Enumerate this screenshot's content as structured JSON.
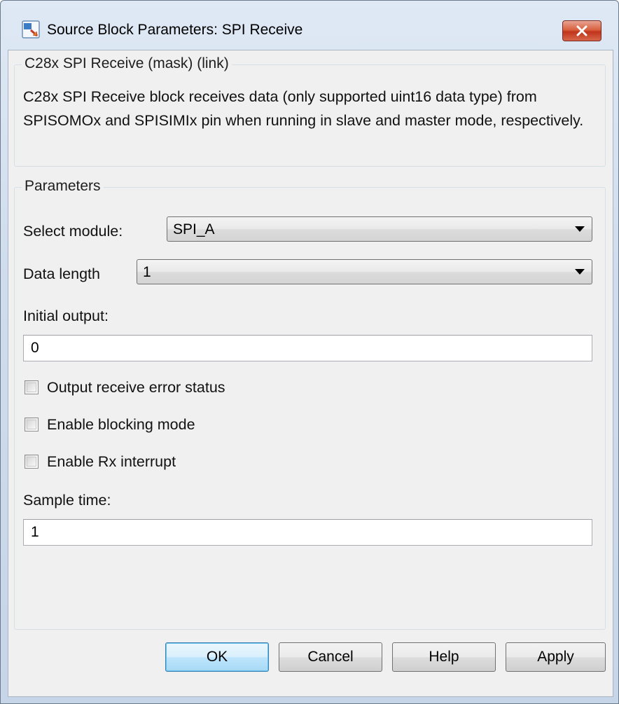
{
  "window": {
    "title": "Source Block Parameters: SPI Receive"
  },
  "description": {
    "legend": "C28x SPI Receive (mask) (link)",
    "text": "C28x SPI Receive block receives data (only supported uint16 data type) from SPISOMOx and SPISIMIx pin when running in slave and master mode, respectively."
  },
  "parameters": {
    "legend": "Parameters",
    "select_module": {
      "label": "Select module:",
      "value": "SPI_A"
    },
    "data_length": {
      "label": "Data length",
      "value": "1"
    },
    "initial_output": {
      "label": "Initial output:",
      "value": "0"
    },
    "output_receive_error_status": {
      "label": "Output receive error status",
      "checked": false
    },
    "enable_blocking_mode": {
      "label": "Enable blocking mode",
      "checked": false
    },
    "enable_rx_interrupt": {
      "label": "Enable Rx interrupt",
      "checked": false
    },
    "sample_time": {
      "label": "Sample time:",
      "value": "1"
    }
  },
  "buttons": {
    "ok": "OK",
    "cancel": "Cancel",
    "help": "Help",
    "apply": "Apply"
  },
  "icons": {
    "app": "simulink-block-icon",
    "close": "close-icon"
  },
  "colors": {
    "close_button": "#c7432a",
    "default_button_border": "#3c7fb1",
    "client_background": "#f0f0f0"
  }
}
